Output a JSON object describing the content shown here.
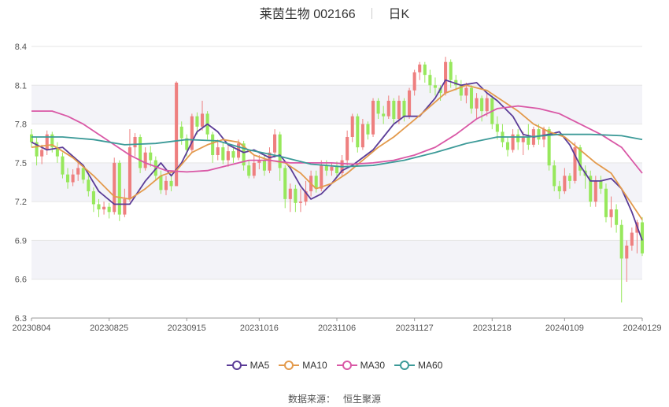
{
  "header": {
    "title": "莱茵生物 002166",
    "period": "日K"
  },
  "source": {
    "label": "数据来源：",
    "value": "恒生聚源"
  },
  "colors": {
    "up": "#ee7f7f",
    "down": "#97e85c",
    "MA5": "#5b3c97",
    "MA10": "#e39a4c",
    "MA30": "#d958a6",
    "MA60": "#3c9a98",
    "band": "#f3f3f8",
    "grid": "#e6e6e6"
  },
  "chart_data": {
    "type": "candlestick",
    "x_tick_labels": [
      "20230804",
      "20230825",
      "20230915",
      "20231016",
      "20231106",
      "20231127",
      "20231218",
      "20240109",
      "20240129"
    ],
    "y_ticks": [
      6.3,
      6.6,
      6.9,
      7.2,
      7.5,
      7.8,
      8.1,
      8.4
    ],
    "ylim": [
      6.3,
      8.4
    ],
    "num_days": 119,
    "ohlc_note": "daily candles, one per trading day",
    "candles": [
      [
        7.72,
        7.66,
        7.76,
        7.62
      ],
      [
        7.66,
        7.55,
        7.7,
        7.48
      ],
      [
        7.55,
        7.6,
        7.64,
        7.49
      ],
      [
        7.6,
        7.72,
        7.75,
        7.56
      ],
      [
        7.72,
        7.62,
        7.74,
        7.58
      ],
      [
        7.62,
        7.55,
        7.66,
        7.5
      ],
      [
        7.55,
        7.41,
        7.58,
        7.38
      ],
      [
        7.41,
        7.35,
        7.46,
        7.3
      ],
      [
        7.35,
        7.41,
        7.45,
        7.32
      ],
      [
        7.41,
        7.46,
        7.5,
        7.36
      ],
      [
        7.46,
        7.37,
        7.48,
        7.34
      ],
      [
        7.37,
        7.28,
        7.4,
        7.24
      ],
      [
        7.28,
        7.18,
        7.31,
        7.12
      ],
      [
        7.18,
        7.14,
        7.22,
        7.08
      ],
      [
        7.14,
        7.16,
        7.2,
        7.1
      ],
      [
        7.16,
        7.12,
        7.19,
        7.07
      ],
      [
        7.12,
        7.5,
        7.54,
        7.1
      ],
      [
        7.5,
        7.1,
        7.52,
        7.05
      ],
      [
        7.1,
        7.22,
        7.3,
        7.08
      ],
      [
        7.22,
        7.62,
        7.76,
        7.2
      ],
      [
        7.62,
        7.7,
        7.73,
        7.55
      ],
      [
        7.7,
        7.46,
        7.72,
        7.42
      ],
      [
        7.46,
        7.58,
        7.62,
        7.44
      ],
      [
        7.58,
        7.52,
        7.63,
        7.47
      ],
      [
        7.52,
        7.4,
        7.55,
        7.36
      ],
      [
        7.4,
        7.29,
        7.44,
        7.26
      ],
      [
        7.29,
        7.36,
        7.4,
        7.25
      ],
      [
        7.36,
        7.32,
        7.4,
        7.28
      ],
      [
        7.32,
        8.12,
        8.13,
        7.35
      ],
      [
        7.78,
        7.69,
        7.82,
        7.64
      ],
      [
        7.69,
        7.6,
        7.72,
        7.55
      ],
      [
        7.6,
        7.86,
        7.88,
        7.58
      ],
      [
        7.86,
        7.78,
        7.89,
        7.72
      ],
      [
        7.78,
        7.88,
        7.98,
        7.75
      ],
      [
        7.88,
        7.72,
        7.9,
        7.68
      ],
      [
        7.72,
        7.56,
        7.74,
        7.5
      ],
      [
        7.56,
        7.62,
        7.68,
        7.52
      ],
      [
        7.62,
        7.52,
        7.66,
        7.49
      ],
      [
        7.52,
        7.59,
        7.63,
        7.47
      ],
      [
        7.59,
        7.54,
        7.62,
        7.5
      ],
      [
        7.54,
        7.65,
        7.68,
        7.52
      ],
      [
        7.65,
        7.48,
        7.67,
        7.44
      ],
      [
        7.48,
        7.4,
        7.52,
        7.38
      ],
      [
        7.4,
        7.5,
        7.56,
        7.38
      ],
      [
        7.5,
        7.52,
        7.56,
        7.45
      ],
      [
        7.52,
        7.44,
        7.56,
        7.4
      ],
      [
        7.44,
        7.58,
        7.62,
        7.42
      ],
      [
        7.58,
        7.72,
        7.76,
        7.54
      ],
      [
        7.72,
        7.46,
        7.74,
        7.36
      ],
      [
        7.46,
        7.22,
        7.48,
        7.15
      ],
      [
        7.22,
        7.3,
        7.34,
        7.12
      ],
      [
        7.3,
        7.19,
        7.33,
        7.12
      ],
      [
        7.19,
        7.2,
        7.3,
        7.12
      ],
      [
        7.2,
        7.28,
        7.36,
        7.17
      ],
      [
        7.28,
        7.4,
        7.44,
        7.24
      ],
      [
        7.4,
        7.3,
        7.44,
        7.27
      ],
      [
        7.3,
        7.48,
        7.52,
        7.28
      ],
      [
        7.48,
        7.44,
        7.52,
        7.4
      ],
      [
        7.44,
        7.47,
        7.5,
        7.4
      ],
      [
        7.47,
        7.42,
        7.51,
        7.39
      ],
      [
        7.42,
        7.52,
        7.56,
        7.4
      ],
      [
        7.52,
        7.7,
        7.75,
        7.48
      ],
      [
        7.7,
        7.86,
        7.88,
        7.66
      ],
      [
        7.86,
        7.62,
        7.88,
        7.58
      ],
      [
        7.62,
        7.8,
        7.84,
        7.6
      ],
      [
        7.8,
        7.72,
        7.82,
        7.68
      ],
      [
        7.72,
        7.98,
        8.0,
        7.7
      ],
      [
        7.98,
        7.88,
        8.0,
        7.84
      ],
      [
        7.88,
        7.86,
        7.94,
        7.8
      ],
      [
        7.86,
        7.98,
        8.02,
        7.84
      ],
      [
        7.98,
        7.84,
        8.0,
        7.8
      ],
      [
        7.84,
        7.98,
        8.02,
        7.8
      ],
      [
        7.98,
        7.86,
        8.0,
        7.82
      ],
      [
        7.86,
        8.06,
        8.08,
        7.84
      ],
      [
        8.06,
        8.2,
        8.22,
        8.02
      ],
      [
        8.2,
        8.26,
        8.28,
        8.14
      ],
      [
        8.26,
        8.18,
        8.28,
        8.12
      ],
      [
        8.18,
        8.1,
        8.22,
        8.04
      ],
      [
        8.1,
        8.08,
        8.16,
        8.02
      ],
      [
        8.08,
        8.04,
        8.1,
        7.98
      ],
      [
        8.04,
        8.28,
        8.32,
        8.02
      ],
      [
        8.28,
        8.14,
        8.3,
        8.08
      ],
      [
        8.14,
        8.1,
        8.18,
        8.06
      ],
      [
        8.1,
        8.02,
        8.14,
        7.98
      ],
      [
        8.02,
        8.08,
        8.12,
        7.96
      ],
      [
        8.08,
        7.92,
        8.1,
        7.88
      ],
      [
        7.92,
        8.0,
        8.04,
        7.84
      ],
      [
        8.0,
        7.9,
        8.02,
        7.82
      ],
      [
        7.9,
        8.0,
        8.04,
        7.86
      ],
      [
        8.0,
        7.8,
        8.02,
        7.76
      ],
      [
        7.8,
        7.74,
        7.86,
        7.68
      ],
      [
        7.74,
        7.66,
        7.8,
        7.62
      ],
      [
        7.66,
        7.6,
        7.7,
        7.55
      ],
      [
        7.6,
        7.72,
        7.76,
        7.58
      ],
      [
        7.72,
        7.66,
        7.76,
        7.6
      ],
      [
        7.66,
        7.7,
        7.74,
        7.56
      ],
      [
        7.7,
        7.64,
        7.8,
        7.6
      ],
      [
        7.64,
        7.76,
        7.78,
        7.62
      ],
      [
        7.76,
        7.68,
        7.8,
        7.64
      ],
      [
        7.68,
        7.76,
        7.78,
        7.62
      ],
      [
        7.76,
        7.48,
        7.78,
        7.44
      ],
      [
        7.48,
        7.32,
        7.52,
        7.28
      ],
      [
        7.32,
        7.28,
        7.36,
        7.22
      ],
      [
        7.28,
        7.4,
        7.46,
        7.26
      ],
      [
        7.4,
        7.36,
        7.42,
        7.3
      ],
      [
        7.36,
        7.62,
        7.66,
        7.34
      ],
      [
        7.62,
        7.44,
        7.64,
        7.4
      ],
      [
        7.44,
        7.4,
        7.48,
        7.3
      ],
      [
        7.4,
        7.2,
        7.44,
        7.16
      ],
      [
        7.2,
        7.36,
        7.4,
        7.16
      ],
      [
        7.36,
        7.3,
        7.4,
        7.26
      ],
      [
        7.3,
        7.08,
        7.34,
        7.04
      ],
      [
        7.08,
        7.14,
        7.24,
        7.0
      ],
      [
        7.14,
        7.02,
        7.18,
        6.96
      ],
      [
        7.02,
        6.76,
        7.06,
        6.42
      ],
      [
        6.76,
        6.86,
        6.9,
        6.58
      ],
      [
        6.86,
        6.96,
        7.0,
        6.82
      ],
      [
        6.96,
        7.04,
        7.06,
        6.8
      ],
      [
        7.04,
        6.8,
        7.08,
        6.78
      ]
    ],
    "series": [
      {
        "name": "MA5",
        "points": [
          [
            0,
            7.66
          ],
          [
            3,
            7.6
          ],
          [
            6,
            7.62
          ],
          [
            10,
            7.48
          ],
          [
            13,
            7.28
          ],
          [
            16,
            7.18
          ],
          [
            19,
            7.18
          ],
          [
            22,
            7.36
          ],
          [
            25,
            7.5
          ],
          [
            27,
            7.4
          ],
          [
            29,
            7.5
          ],
          [
            32,
            7.74
          ],
          [
            34,
            7.8
          ],
          [
            36,
            7.74
          ],
          [
            38,
            7.64
          ],
          [
            41,
            7.58
          ],
          [
            43,
            7.6
          ],
          [
            46,
            7.54
          ],
          [
            48,
            7.56
          ],
          [
            50,
            7.46
          ],
          [
            52,
            7.32
          ],
          [
            54,
            7.22
          ],
          [
            56,
            7.26
          ],
          [
            58,
            7.34
          ],
          [
            60,
            7.44
          ],
          [
            62,
            7.48
          ],
          [
            66,
            7.6
          ],
          [
            68,
            7.7
          ],
          [
            70,
            7.8
          ],
          [
            72,
            7.86
          ],
          [
            75,
            7.86
          ],
          [
            78,
            8.0
          ],
          [
            80,
            8.14
          ],
          [
            83,
            8.1
          ],
          [
            86,
            8.12
          ],
          [
            88,
            8.04
          ],
          [
            90,
            7.98
          ],
          [
            93,
            7.86
          ],
          [
            95,
            7.72
          ],
          [
            97,
            7.7
          ],
          [
            100,
            7.72
          ],
          [
            102,
            7.74
          ],
          [
            104,
            7.64
          ],
          [
            106,
            7.48
          ],
          [
            108,
            7.36
          ],
          [
            110,
            7.36
          ],
          [
            112,
            7.38
          ],
          [
            114,
            7.3
          ],
          [
            116,
            7.12
          ],
          [
            118,
            6.9
          ]
        ]
      },
      {
        "name": "MA10",
        "points": [
          [
            0,
            7.62
          ],
          [
            4,
            7.64
          ],
          [
            8,
            7.54
          ],
          [
            12,
            7.4
          ],
          [
            16,
            7.24
          ],
          [
            19,
            7.22
          ],
          [
            22,
            7.3
          ],
          [
            25,
            7.4
          ],
          [
            28,
            7.44
          ],
          [
            31,
            7.58
          ],
          [
            34,
            7.64
          ],
          [
            37,
            7.68
          ],
          [
            40,
            7.66
          ],
          [
            43,
            7.56
          ],
          [
            46,
            7.52
          ],
          [
            49,
            7.5
          ],
          [
            52,
            7.42
          ],
          [
            55,
            7.3
          ],
          [
            58,
            7.34
          ],
          [
            61,
            7.42
          ],
          [
            64,
            7.52
          ],
          [
            67,
            7.62
          ],
          [
            70,
            7.7
          ],
          [
            73,
            7.8
          ],
          [
            76,
            7.9
          ],
          [
            80,
            8.04
          ],
          [
            84,
            8.1
          ],
          [
            88,
            8.06
          ],
          [
            91,
            7.98
          ],
          [
            94,
            7.9
          ],
          [
            97,
            7.8
          ],
          [
            100,
            7.74
          ],
          [
            103,
            7.7
          ],
          [
            106,
            7.6
          ],
          [
            109,
            7.5
          ],
          [
            112,
            7.42
          ],
          [
            115,
            7.24
          ],
          [
            118,
            7.06
          ]
        ]
      },
      {
        "name": "MA30",
        "points": [
          [
            0,
            7.9
          ],
          [
            4,
            7.9
          ],
          [
            7,
            7.86
          ],
          [
            10,
            7.8
          ],
          [
            13,
            7.72
          ],
          [
            16,
            7.64
          ],
          [
            19,
            7.56
          ],
          [
            22,
            7.5
          ],
          [
            26,
            7.44
          ],
          [
            30,
            7.43
          ],
          [
            34,
            7.44
          ],
          [
            38,
            7.48
          ],
          [
            42,
            7.52
          ],
          [
            46,
            7.52
          ],
          [
            50,
            7.5
          ],
          [
            54,
            7.5
          ],
          [
            58,
            7.5
          ],
          [
            62,
            7.49
          ],
          [
            66,
            7.5
          ],
          [
            70,
            7.52
          ],
          [
            74,
            7.56
          ],
          [
            78,
            7.62
          ],
          [
            82,
            7.72
          ],
          [
            86,
            7.84
          ],
          [
            90,
            7.92
          ],
          [
            94,
            7.94
          ],
          [
            98,
            7.92
          ],
          [
            102,
            7.88
          ],
          [
            106,
            7.8
          ],
          [
            110,
            7.72
          ],
          [
            114,
            7.62
          ],
          [
            118,
            7.42
          ]
        ]
      },
      {
        "name": "MA60",
        "points": [
          [
            0,
            7.7
          ],
          [
            6,
            7.7
          ],
          [
            12,
            7.68
          ],
          [
            18,
            7.64
          ],
          [
            24,
            7.65
          ],
          [
            30,
            7.68
          ],
          [
            36,
            7.67
          ],
          [
            42,
            7.6
          ],
          [
            48,
            7.55
          ],
          [
            54,
            7.49
          ],
          [
            60,
            7.47
          ],
          [
            66,
            7.48
          ],
          [
            72,
            7.52
          ],
          [
            78,
            7.58
          ],
          [
            84,
            7.65
          ],
          [
            90,
            7.7
          ],
          [
            96,
            7.7
          ],
          [
            102,
            7.72
          ],
          [
            108,
            7.72
          ],
          [
            114,
            7.71
          ],
          [
            118,
            7.68
          ]
        ]
      }
    ],
    "legend_position": "bottom-center",
    "grid": true
  }
}
